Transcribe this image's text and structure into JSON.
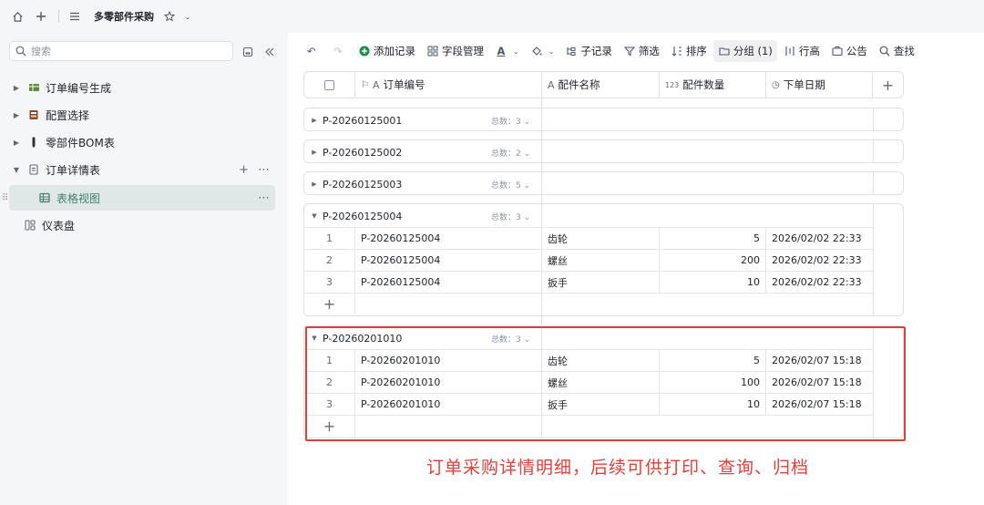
{
  "topbar": {
    "title": "多零部件采购"
  },
  "sidebar": {
    "search_placeholder": "搜索",
    "items": [
      {
        "label": "订单编号生成",
        "icon": "table-icon",
        "color": "#5b8c3a"
      },
      {
        "label": "配置选择",
        "icon": "table-icon",
        "color": "#8a4b2a"
      },
      {
        "label": "零部件BOM表",
        "icon": "table-icon",
        "color": "#333333"
      },
      {
        "label": "订单详情表",
        "icon": "doc-icon",
        "color": "#646a73"
      },
      {
        "label": "表格视图",
        "icon": "grid-icon",
        "color": "#3f7f6e"
      },
      {
        "label": "仪表盘",
        "icon": "dashboard-icon",
        "color": "#646a73"
      }
    ]
  },
  "toolbar": {
    "add": "添加记录",
    "fields": "字段管理",
    "subrecord": "子记录",
    "filter": "筛选",
    "sort": "排序",
    "group": "分组 (1)",
    "rowheight": "行高",
    "notice": "公告",
    "find": "查找"
  },
  "columns": {
    "order_no": "订单编号",
    "part_name": "配件名称",
    "part_qty": "配件数量",
    "order_date": "下单日期",
    "qty_icon_text": "123"
  },
  "groups": [
    {
      "name": "P-20260125001",
      "count": "总数：3"
    },
    {
      "name": "P-20260125002",
      "count": "总数：2"
    },
    {
      "name": "P-20260125003",
      "count": "总数：5"
    },
    {
      "name": "P-20260125004",
      "count": "总数：3",
      "rows": [
        {
          "idx": "1",
          "id": "P-20260125004",
          "name": "齿轮",
          "qty": "5",
          "date": "2026/02/02 22:33"
        },
        {
          "idx": "2",
          "id": "P-20260125004",
          "name": "螺丝",
          "qty": "200",
          "date": "2026/02/02 22:33"
        },
        {
          "idx": "3",
          "id": "P-20260125004",
          "name": "扳手",
          "qty": "10",
          "date": "2026/02/02 22:33"
        }
      ]
    },
    {
      "name": "P-20260201010",
      "count": "总数：3",
      "rows": [
        {
          "idx": "1",
          "id": "P-20260201010",
          "name": "齿轮",
          "qty": "5",
          "date": "2026/02/07 15:18"
        },
        {
          "idx": "2",
          "id": "P-20260201010",
          "name": "螺丝",
          "qty": "100",
          "date": "2026/02/07 15:18"
        },
        {
          "idx": "3",
          "id": "P-20260201010",
          "name": "扳手",
          "qty": "10",
          "date": "2026/02/07 15:18"
        }
      ]
    }
  ],
  "annotation": "订单采购详情明细，后续可供打印、查询、归档",
  "colors": {
    "accent": "#3f7f6e",
    "annotation": "#e0403c",
    "add_icon": "#1f8a4c"
  }
}
